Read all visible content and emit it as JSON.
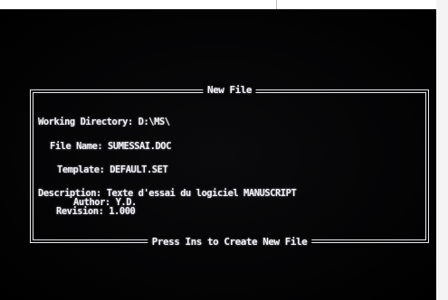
{
  "dialog": {
    "title": "New File",
    "footer": "Press Ins to Create New File"
  },
  "fields": {
    "working_directory": {
      "label": "Working Directory:",
      "value": "D:\\MS\\"
    },
    "file_name": {
      "label": "File Name:",
      "value": "SUMESSAI.DOC"
    },
    "template": {
      "label": "Template:",
      "value": "DEFAULT.SET"
    },
    "description": {
      "label": "Description:",
      "value": "Texte d'essai du logiciel MANUSCRIPT"
    },
    "author": {
      "label": "Author:",
      "value": "Y.D."
    },
    "revision": {
      "label": "Revision:",
      "value": "1.000"
    }
  },
  "colors": {
    "screen_background": "#030304",
    "text": "#f0f0f6",
    "border": "#e9e9ef"
  }
}
